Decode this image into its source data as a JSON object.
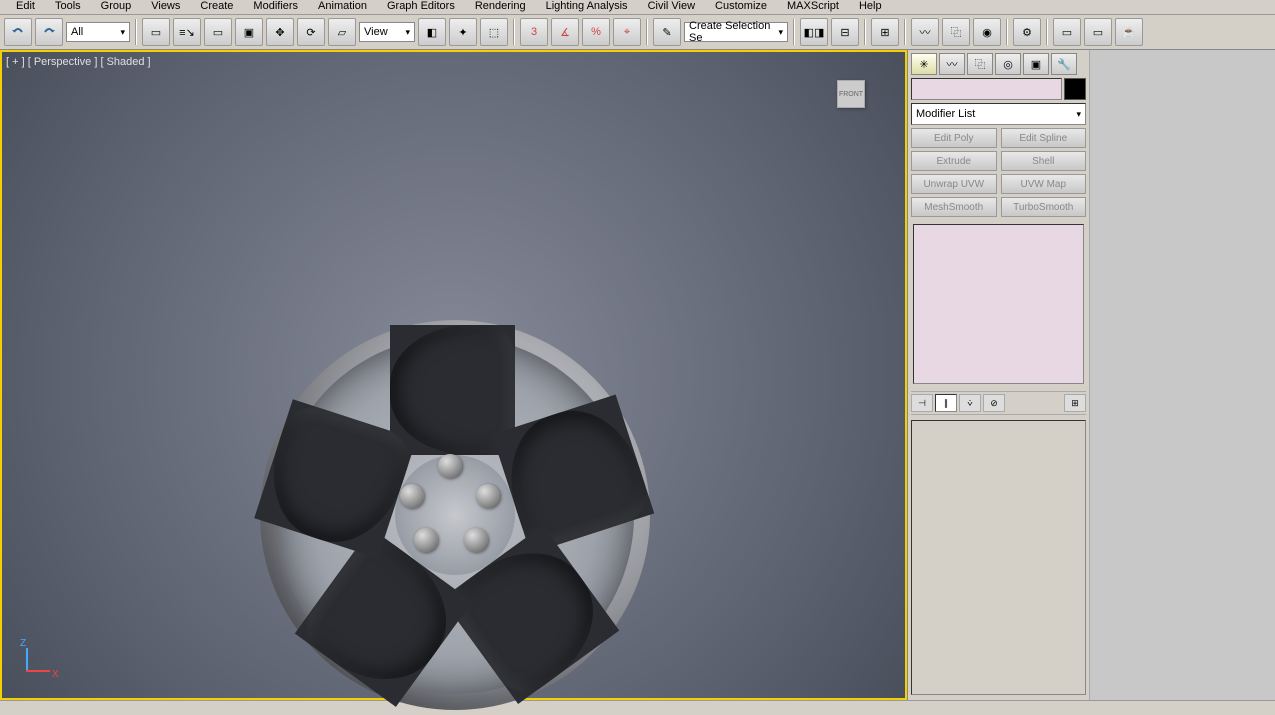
{
  "menu": {
    "items": [
      "Edit",
      "Tools",
      "Group",
      "Views",
      "Create",
      "Modifiers",
      "Animation",
      "Graph Editors",
      "Rendering",
      "Lighting Analysis",
      "Civil View",
      "Customize",
      "MAXScript",
      "Help"
    ]
  },
  "toolbar": {
    "filter_dropdown": "All",
    "view_dropdown": "View",
    "selection_set_dropdown": "Create Selection Se"
  },
  "viewport": {
    "label": "[ + ] [ Perspective ] [ Shaded ]",
    "viewcube_face": "FRONT",
    "axis_z": "Z",
    "axis_x": "X"
  },
  "panel": {
    "tabs": [
      "create",
      "modify",
      "hierarchy",
      "motion",
      "display",
      "utilities"
    ],
    "name": "",
    "modifier_dropdown": "Modifier List",
    "quick_mods": [
      [
        "Edit Poly",
        "Edit Spline"
      ],
      [
        "Extrude",
        "Shell"
      ],
      [
        "Unwrap UVW",
        "UVW Map"
      ],
      [
        "MeshSmooth",
        "TurboSmooth"
      ]
    ]
  }
}
